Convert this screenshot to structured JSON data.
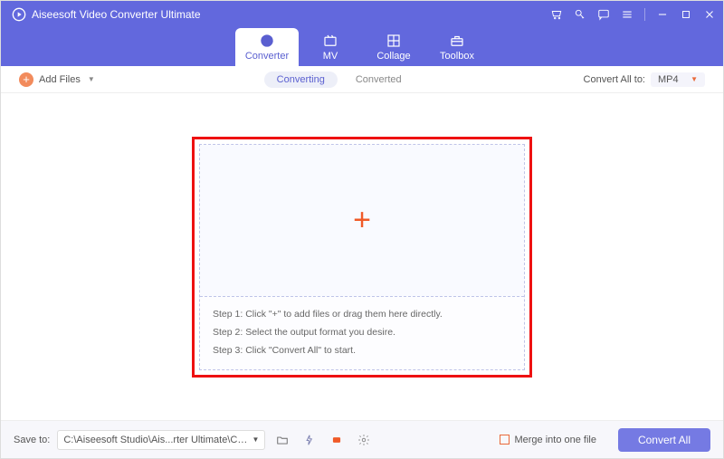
{
  "titlebar": {
    "title": "Aiseesoft Video Converter Ultimate"
  },
  "tabs": {
    "converter": "Converter",
    "mv": "MV",
    "collage": "Collage",
    "toolbox": "Toolbox"
  },
  "toolbar": {
    "add_files": "Add Files",
    "converting": "Converting",
    "converted": "Converted",
    "convert_all_to": "Convert All to:",
    "format": "MP4"
  },
  "dropzone": {
    "step1": "Step 1: Click \"+\" to add files or drag them here directly.",
    "step2": "Step 2: Select the output format you desire.",
    "step3": "Step 3: Click \"Convert All\" to start."
  },
  "bottom": {
    "save_to": "Save to:",
    "path": "C:\\Aiseesoft Studio\\Ais...rter Ultimate\\Converted",
    "merge": "Merge into one file",
    "convert_all": "Convert All"
  }
}
